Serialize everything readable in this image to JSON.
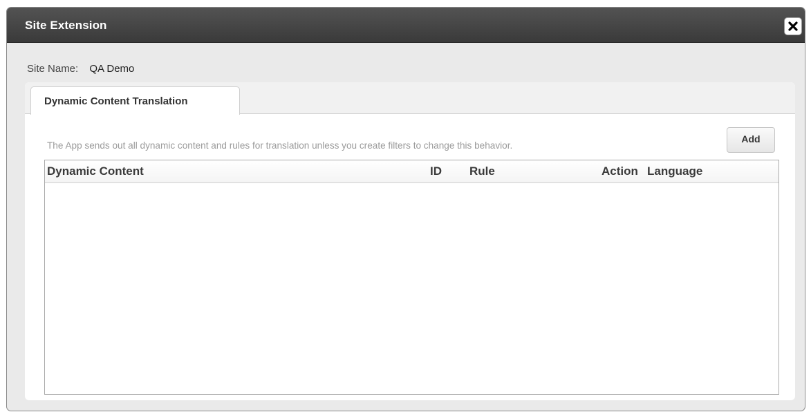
{
  "dialog": {
    "title": "Site Extension"
  },
  "site": {
    "label": "Site Name:",
    "value": "QA Demo"
  },
  "tabs": [
    {
      "label": "Dynamic Content Translation",
      "active": true
    }
  ],
  "content": {
    "description": "The App sends out all dynamic content and rules for translation unless you create filters to change this behavior.",
    "add_label": "Add"
  },
  "table": {
    "columns": [
      "Dynamic Content",
      "ID",
      "Rule",
      "Action",
      "Language"
    ],
    "rows": []
  },
  "icons": {
    "close": "close-icon"
  },
  "colors": {
    "titlebar": "#404040",
    "dialog_bg": "#eaeaea",
    "panel_bg": "#ffffff",
    "description_text": "#9a9a9a"
  }
}
